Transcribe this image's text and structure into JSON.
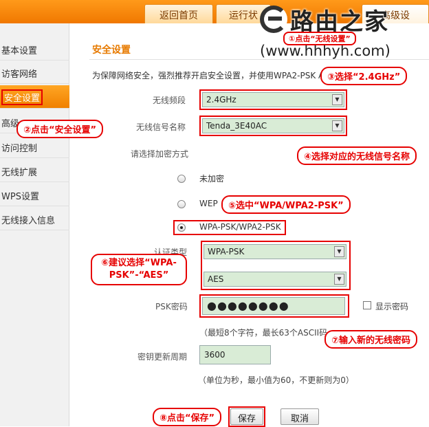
{
  "header": {
    "tabs": [
      {
        "label": "返回首页"
      },
      {
        "label": "运行状"
      },
      {
        "label": "高级设"
      }
    ]
  },
  "logo": {
    "name": "路由之家",
    "url": "(www.hhhyh.com)"
  },
  "sidebar": {
    "items": [
      {
        "label": "基本设置"
      },
      {
        "label": "访客网络"
      },
      {
        "label": "安全设置"
      },
      {
        "label": "高级"
      },
      {
        "label": "访问控制"
      },
      {
        "label": "无线扩展"
      },
      {
        "label": "WPS设置"
      },
      {
        "label": "无线接入信息"
      }
    ]
  },
  "main": {
    "section_title": "安全设置",
    "intro": "为保障网络安全，强烈推荐开启安全设置，并使用WPA2-PSK A",
    "band": {
      "label": "无线频段",
      "value": "2.4GHz"
    },
    "ssid": {
      "label": "无线信号名称",
      "value": "Tenda_3E40AC"
    },
    "encryption_prompt": "请选择加密方式",
    "options": [
      {
        "label": "未加密",
        "checked": false
      },
      {
        "label": "WEP",
        "checked": false
      },
      {
        "label": "WPA-PSK/WPA2-PSK",
        "checked": true
      }
    ],
    "auth": {
      "label": "认证类型",
      "value": "WPA-PSK"
    },
    "cipher": {
      "value": "AES"
    },
    "psk": {
      "label": "PSK密码",
      "value": "●●●●●●●●",
      "show_label": "显示密码"
    },
    "psk_hint": "（最短8个字符，最长63个ASCII码",
    "rekey": {
      "label": "密钥更新周期",
      "value": "3600"
    },
    "rekey_hint": "（单位为秒，最小值为60，不更新则为0）",
    "save_label": "保存",
    "cancel_label": "取消"
  },
  "callouts": {
    "c1": "①点击“无线设置”",
    "c2": "②点击“安全设置”",
    "c3": "③选择“2.4GHz”",
    "c4": "④选择对应的无线信号名称",
    "c5": "⑤选中“WPA/WPA2-PSK”",
    "c6a": "⑥建议选择“WPA-",
    "c6b": "PSK”-“AES”",
    "c7": "⑦输入新的无线密码",
    "c8": "⑧点击“保存”"
  },
  "colors": {
    "accent": "#f08000",
    "annotation": "#e60000",
    "field_bg": "#d9ecd6"
  }
}
